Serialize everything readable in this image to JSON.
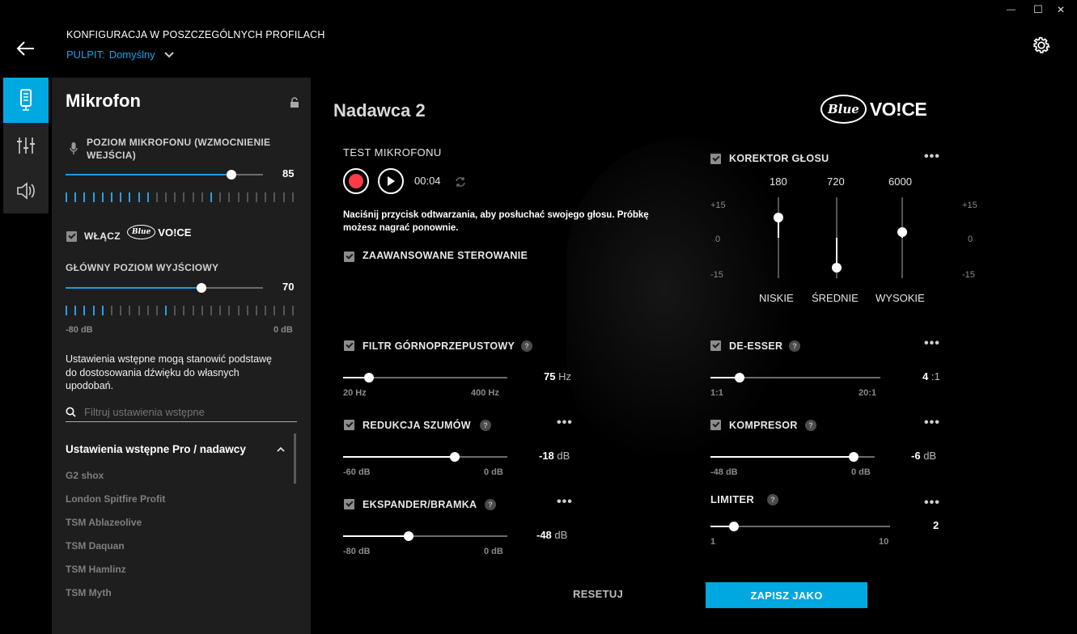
{
  "header": {
    "title": "KONFIGURACJA W POSZCZEGÓLNYCH PROFILACH",
    "profile_prefix": "PULPIT:",
    "profile_name": "Domyślny"
  },
  "window": {
    "minimize": "—",
    "maximize": "☐",
    "close": "✕"
  },
  "panel": {
    "title": "Mikrofon",
    "mic_level_label": "POZIOM MIKROFONU (WZMOCNIENIE WEJŚCIA)",
    "mic_level_value": "85",
    "mic_level_fraction": 0.84,
    "enable_label": "WŁĄCZ",
    "output_label": "GŁÓWNY POZIOM WYJŚCIOWY",
    "output_value": "70",
    "output_fraction": 0.69,
    "range_min": "-80 dB",
    "range_max": "0 dB",
    "preset_desc": "Ustawienia wstępne mogą stanowić podstawę do dostosowania dźwięku do własnych upodobań.",
    "filter_placeholder": "Filtruj ustawienia wstępne",
    "preset_group": "Ustawienia wstępne Pro / nadawcy",
    "presets": [
      "G2 shox",
      "London Spitfire Profit",
      "TSM Ablazeolive",
      "TSM Daquan",
      "TSM Hamlinz",
      "TSM Myth"
    ]
  },
  "main": {
    "preset_title": "Nadawca 2",
    "brand_blue": "Blue",
    "brand_voice": "VO!CE",
    "test_label": "TEST MIKROFONU",
    "test_time": "00:04",
    "test_hint": "Naciśnij przycisk odtwarzania, aby posłuchać swojego głosu. Próbkę możesz nagrać ponownie.",
    "advanced_label": "ZAAWANSOWANE STEROWANIE",
    "highpass": {
      "label": "FILTR GÓRNOPRZEPUSTOWY",
      "value": "75",
      "unit": "Hz",
      "min": "20 Hz",
      "max": "400 Hz",
      "fraction": 0.16
    },
    "noise": {
      "label": "REDUKCJA SZUMÓW",
      "value": "-18",
      "unit": "dB",
      "min": "-60 dB",
      "max": "0 dB",
      "fraction": 0.68
    },
    "expander": {
      "label": "EKSPANDER/BRAMKA",
      "value": "-48",
      "unit": "dB",
      "min": "-80 dB",
      "max": "0 dB",
      "fraction": 0.4
    },
    "eq": {
      "label": "KOREKTOR GŁOSU",
      "bands": [
        {
          "freq": "180",
          "name": "NISKIE",
          "level": 0.75
        },
        {
          "freq": "720",
          "name": "ŚREDNIE",
          "level": 0.13
        },
        {
          "freq": "6000",
          "name": "WYSOKIE",
          "level": 0.57
        }
      ],
      "scale_top": "+15",
      "scale_mid": "0",
      "scale_bot": "-15"
    },
    "deesser": {
      "label": "DE-ESSER",
      "value": "4",
      "unit": ":1",
      "min": "1:1",
      "max": "20:1",
      "fraction": 0.17
    },
    "compressor": {
      "label": "KOMPRESOR",
      "value": "-6",
      "unit": "dB",
      "min": "-48 dB",
      "max": "0 dB",
      "fraction": 0.87
    },
    "limiter": {
      "label": "LIMITER",
      "value": "2",
      "min": "1",
      "max": "10",
      "fraction": 0.13
    },
    "reset_label": "RESETUJ",
    "save_label": "ZAPISZ JAKO"
  },
  "colors": {
    "accent": "#00a8e1",
    "panel": "#1e1e1e",
    "record": "#ff3b46"
  }
}
